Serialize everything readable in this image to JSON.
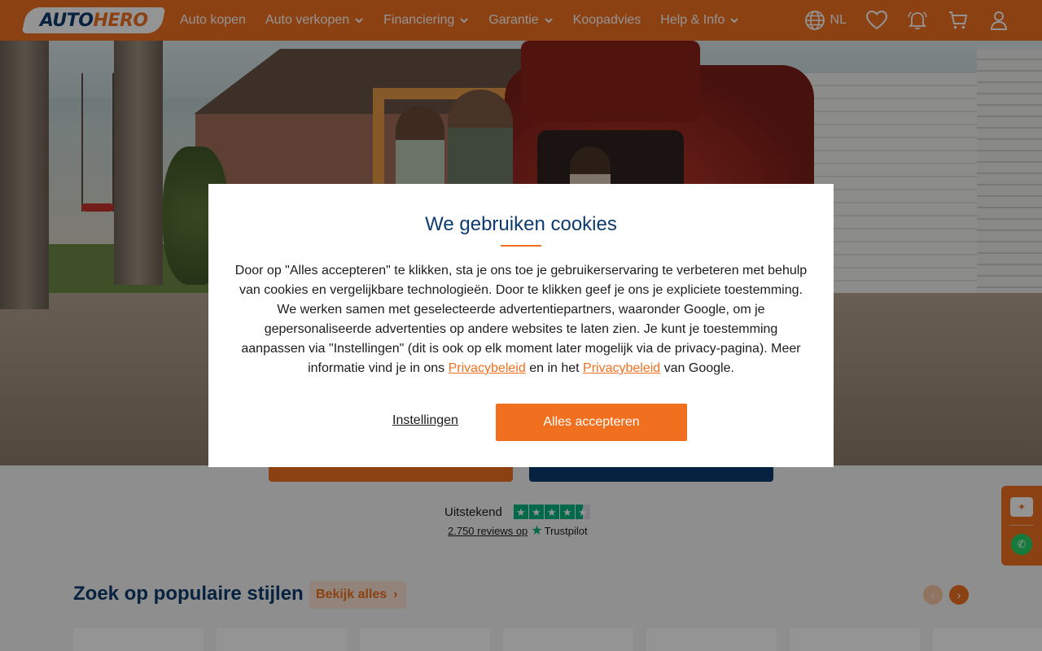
{
  "header": {
    "logo_prefix": "AUTO",
    "logo_suffix": "HERO",
    "nav": [
      {
        "label": "Auto kopen",
        "dropdown": false
      },
      {
        "label": "Auto verkopen",
        "dropdown": true
      },
      {
        "label": "Financiering",
        "dropdown": true
      },
      {
        "label": "Garantie",
        "dropdown": true
      },
      {
        "label": "Koopadvies",
        "dropdown": false
      },
      {
        "label": "Help & Info",
        "dropdown": true
      }
    ],
    "language": "NL",
    "icons": [
      "globe-icon",
      "heart-icon",
      "bell-icon",
      "cart-icon",
      "user-icon"
    ]
  },
  "trustpilot": {
    "label": "Uitstekend",
    "reviews": "2.750 reviews op",
    "brand": "Trustpilot",
    "rating_stars": 4.5
  },
  "section": {
    "title": "Zoek op populaire stijlen",
    "see_all": "Bekijk alles"
  },
  "cookie_modal": {
    "title": "We gebruiken cookies",
    "text_main": "Door op \"Alles accepteren\" te klikken, sta je ons toe je gebruikerservaring te verbeteren met behulp van cookies en vergelijkbare technologieën. Door te klikken geef je ons je expliciete toestemming. We werken samen met geselecteerde advertentiepartners, waaronder Google, om je gepersonaliseerde advertenties op andere websites te laten zien. Je kunt je toestemming aanpassen via \"Instellingen\" (dit is ook op elk moment later mogelijk via de privacy-pagina). Meer informatie vind je in ons ",
    "link1": "Privacybeleid",
    "text_mid": " en in het ",
    "link2": "Privacybeleid",
    "text_end": " van Google.",
    "settings_label": "Instellingen",
    "accept_label": "Alles accepteren"
  },
  "colors": {
    "brand_orange": "#f1701f",
    "brand_blue": "#0d3b6e",
    "trustpilot_green": "#00b67a"
  }
}
